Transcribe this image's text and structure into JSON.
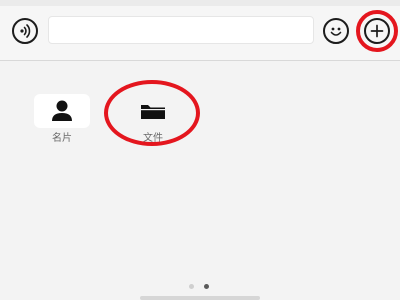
{
  "toolbar": {
    "voice_icon": "voice-wave-icon",
    "input_value": "",
    "input_placeholder": "",
    "emoji_icon": "smiley-face-icon",
    "more_icon": "plus-circle-icon"
  },
  "panel": {
    "items": [
      {
        "label": "名片",
        "icon": "person-icon"
      },
      {
        "label": "文件",
        "icon": "folder-icon"
      }
    ],
    "page_count": 2,
    "active_page": 2
  },
  "annotations": {
    "highlight_color": "#e4161e"
  }
}
